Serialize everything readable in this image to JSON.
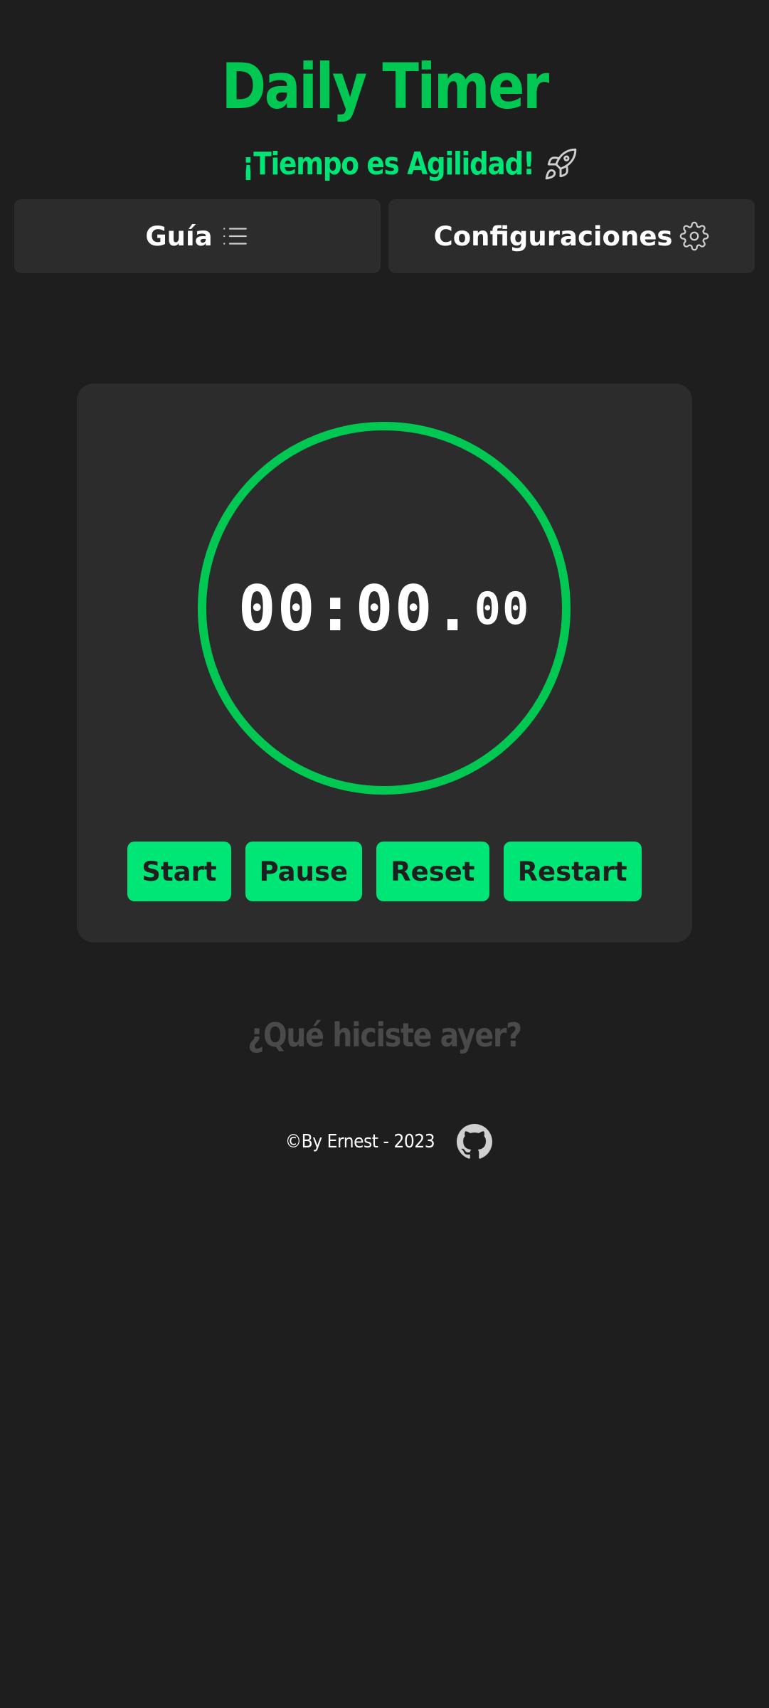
{
  "header": {
    "title": "Daily Timer",
    "subtitle": "¡Tiempo es Agilidad!",
    "subtitle_icon": "rocket-icon"
  },
  "nav": {
    "guide_label": "Guía",
    "guide_icon": "list-icon",
    "config_label": "Configuraciones",
    "config_icon": "gear-icon"
  },
  "timer": {
    "minutes": "00",
    "seconds": "00",
    "hundredths": "00",
    "ring_color": "#00c853",
    "progress": 1.0
  },
  "controls": {
    "start_label": "Start",
    "pause_label": "Pause",
    "reset_label": "Reset",
    "restart_label": "Restart"
  },
  "prompt": {
    "question": "¿Qué hiciste ayer?"
  },
  "footer": {
    "text": "©By Ernest - 2023",
    "icon": "github-icon"
  },
  "colors": {
    "background": "#1e1e1e",
    "card": "#2c2c2c",
    "accent": "#00e676",
    "title_green": "#00c853"
  }
}
